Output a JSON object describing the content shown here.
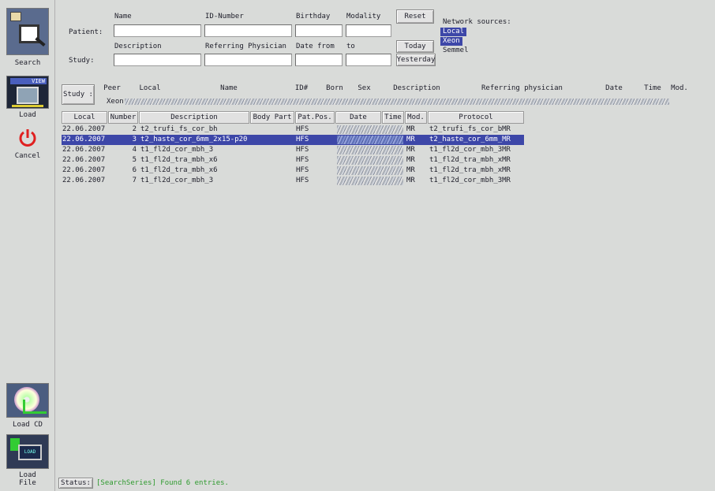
{
  "sidebar": {
    "search_label": "Search",
    "load_label": "Load",
    "cancel_label": "Cancel",
    "load_cd_label": "Load CD",
    "load_file_label": "Load\nFile",
    "view_badge": "VIEW",
    "load_file_badge": "LOAD"
  },
  "search": {
    "patient_label": "Patient:",
    "study_label": "Study:",
    "name_label": "Name",
    "id_label": "ID-Number",
    "birthday_label": "Birthday",
    "modality_label": "Modality",
    "description_label": "Description",
    "referring_label": "Referring Physician",
    "date_from_label": "Date from",
    "to_label": "to",
    "reset_label": "Reset",
    "today_label": "Today",
    "yesterday_label": "Yesterday",
    "fields": {
      "name": "",
      "id": "",
      "birthday": "",
      "modality": "",
      "description": "",
      "referring": "",
      "date_from": "",
      "date_to": ""
    }
  },
  "network": {
    "title": "Network sources:",
    "sources": [
      {
        "label": "Local",
        "selected": true
      },
      {
        "label": "Xeon",
        "selected": true
      },
      {
        "label": "Semmel",
        "selected": false
      }
    ]
  },
  "study_bar": {
    "button_label": "Study :",
    "headers": [
      "Peer",
      "Local",
      "Name",
      "ID#",
      "Born",
      "Sex",
      "Description",
      "Referring physician",
      "Date",
      "Time",
      "Mod."
    ],
    "row_peer": "Xeon"
  },
  "series_table": {
    "headers": [
      "Local",
      "Number",
      "Description",
      "Body Part",
      "Pat.Pos.",
      "Date",
      "Time",
      "Mod.",
      "Protocol"
    ],
    "rows": [
      {
        "local": "22.06.2007",
        "number": "2",
        "description": "t2_trufi_fs_cor_bh",
        "body_part": "",
        "pat_pos": "HFS",
        "mod": "MR",
        "protocol": "t2_trufi_fs_cor_bMR",
        "selected": false
      },
      {
        "local": "22.06.2007",
        "number": "3",
        "description": "t2_haste_cor_6mm_2x15-p20",
        "body_part": "",
        "pat_pos": "HFS",
        "mod": "MR",
        "protocol": "t2_haste_cor_6mm_MR",
        "selected": true
      },
      {
        "local": "22.06.2007",
        "number": "4",
        "description": "t1_fl2d_cor_mbh_3",
        "body_part": "",
        "pat_pos": "HFS",
        "mod": "MR",
        "protocol": "t1_fl2d_cor_mbh_3MR",
        "selected": false
      },
      {
        "local": "22.06.2007",
        "number": "5",
        "description": "t1_fl2d_tra_mbh_x6",
        "body_part": "",
        "pat_pos": "HFS",
        "mod": "MR",
        "protocol": "t1_fl2d_tra_mbh_xMR",
        "selected": false
      },
      {
        "local": "22.06.2007",
        "number": "6",
        "description": "t1_fl2d_tra_mbh_x6",
        "body_part": "",
        "pat_pos": "HFS",
        "mod": "MR",
        "protocol": "t1_fl2d_tra_mbh_xMR",
        "selected": false
      },
      {
        "local": "22.06.2007",
        "number": "7",
        "description": "t1_fl2d_cor_mbh_3",
        "body_part": "",
        "pat_pos": "HFS",
        "mod": "MR",
        "protocol": "t1_fl2d_cor_mbh_3MR",
        "selected": false
      }
    ]
  },
  "status": {
    "label": "Status:",
    "message": "[SearchSeries] Found 6 entries."
  },
  "colors": {
    "selection": "#3d47a8",
    "status_text": "#2e9a2e",
    "panel_bg": "#d9dbd9"
  }
}
